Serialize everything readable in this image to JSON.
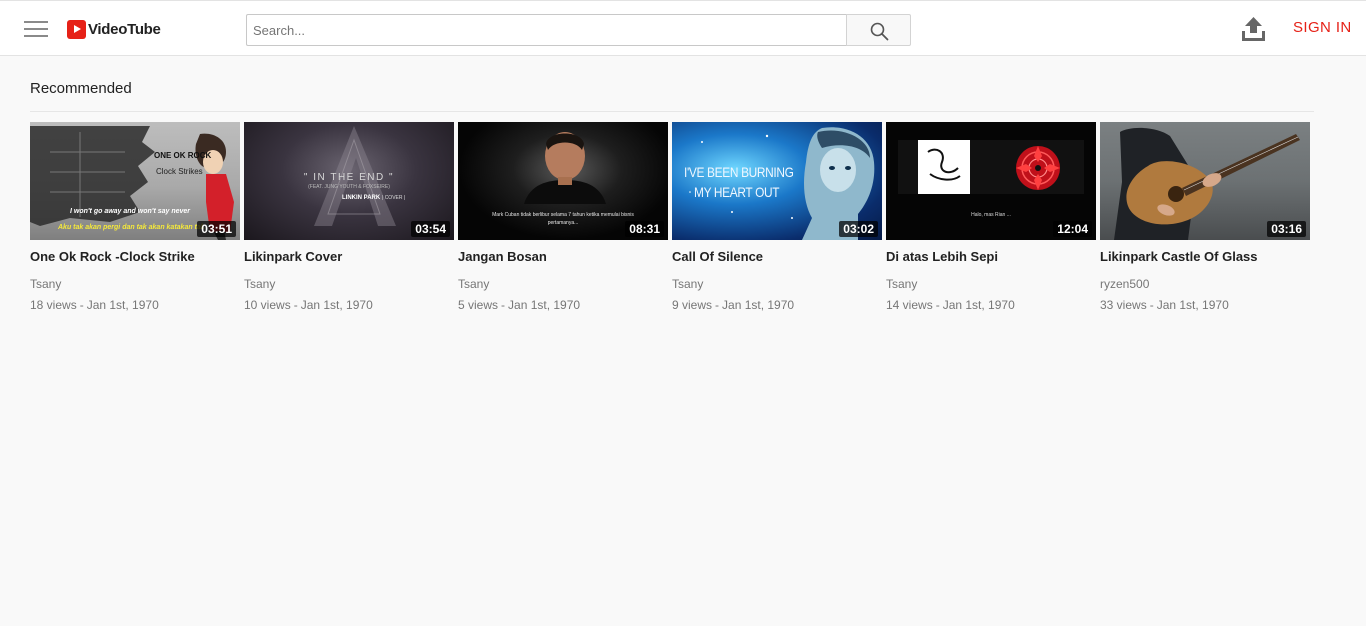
{
  "header": {
    "logo_text": "VideoTube",
    "search_placeholder": "Search...",
    "sign_in_label": "SIGN IN"
  },
  "section": {
    "title": "Recommended"
  },
  "videos": [
    {
      "title": "One Ok Rock -Clock Strike",
      "channel": "Tsany",
      "views": "18 views",
      "date": "Jan 1st, 1970",
      "duration": "03:51",
      "thumb_text": [
        "ONE OK ROCK",
        "Clock Strikes",
        "I won't go away and won't say never",
        "Aku tak akan pergi dan tak akan katakan tak"
      ]
    },
    {
      "title": "Likinpark Cover",
      "channel": "Tsany",
      "views": "10 views",
      "date": "Jan 1st, 1970",
      "duration": "03:54",
      "thumb_text": [
        "\" IN THE END \"",
        "(FEAT. JUNG YOUTH & FOXSEIRE)",
        "LINKIN PARK",
        "| COVER |"
      ]
    },
    {
      "title": "Jangan Bosan",
      "channel": "Tsany",
      "views": "5 views",
      "date": "Jan 1st, 1970",
      "duration": "08:31",
      "thumb_text": [
        "Mark Cuban tidak berlibur selama 7 tahun ketika memulai bisnis",
        "pertamanya..."
      ]
    },
    {
      "title": "Call Of Silence",
      "channel": "Tsany",
      "views": "9 views",
      "date": "Jan 1st, 1970",
      "duration": "03:02",
      "thumb_text": [
        "I'VE BEEN BURNING",
        "MY HEART OUT"
      ]
    },
    {
      "title": "Di atas Lebih Sepi",
      "channel": "Tsany",
      "views": "14 views",
      "date": "Jan 1st, 1970",
      "duration": "12:04",
      "thumb_text": [
        "Halo, mas Rian ..."
      ]
    },
    {
      "title": "Likinpark Castle Of Glass",
      "channel": "ryzen500",
      "views": "33 views",
      "date": "Jan 1st, 1970",
      "duration": "03:16",
      "thumb_text": []
    }
  ],
  "meta_separator": "-",
  "icons": {
    "menu": "hamburger-menu-icon",
    "logo": "play-logo-icon",
    "search": "search-icon",
    "upload": "upload-icon"
  },
  "colors": {
    "brand_red": "#e62117",
    "page_background": "#f9f9f9",
    "header_background": "#ffffff",
    "subtitle_yellow": "#f4e83c"
  }
}
